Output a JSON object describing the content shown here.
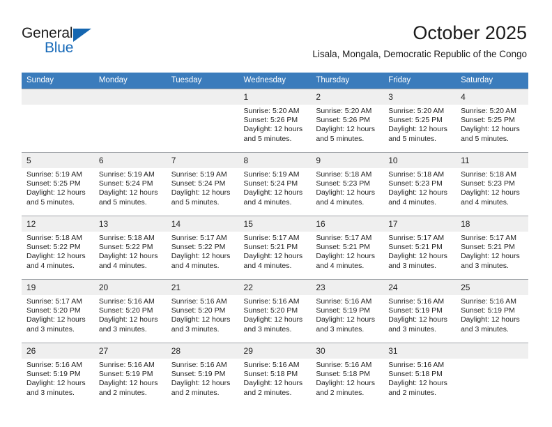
{
  "brand": {
    "name_top": "General",
    "name_bottom": "Blue",
    "accent_color": "#1669b8",
    "triangle_color": "#1566b0"
  },
  "header": {
    "title": "October 2025",
    "subtitle": "Lisala, Mongala, Democratic Republic of the Congo"
  },
  "calendar": {
    "header_background": "#3b7cbc",
    "daynum_background": "#efefef",
    "weekday_headers": [
      "Sunday",
      "Monday",
      "Tuesday",
      "Wednesday",
      "Thursday",
      "Friday",
      "Saturday"
    ],
    "weeks": [
      [
        {
          "day": "",
          "sunrise": "",
          "sunset": "",
          "daylight": "",
          "empty": true
        },
        {
          "day": "",
          "sunrise": "",
          "sunset": "",
          "daylight": "",
          "empty": true
        },
        {
          "day": "",
          "sunrise": "",
          "sunset": "",
          "daylight": "",
          "empty": true
        },
        {
          "day": "1",
          "sunrise": "Sunrise: 5:20 AM",
          "sunset": "Sunset: 5:26 PM",
          "daylight": "Daylight: 12 hours and 5 minutes."
        },
        {
          "day": "2",
          "sunrise": "Sunrise: 5:20 AM",
          "sunset": "Sunset: 5:26 PM",
          "daylight": "Daylight: 12 hours and 5 minutes."
        },
        {
          "day": "3",
          "sunrise": "Sunrise: 5:20 AM",
          "sunset": "Sunset: 5:25 PM",
          "daylight": "Daylight: 12 hours and 5 minutes."
        },
        {
          "day": "4",
          "sunrise": "Sunrise: 5:20 AM",
          "sunset": "Sunset: 5:25 PM",
          "daylight": "Daylight: 12 hours and 5 minutes."
        }
      ],
      [
        {
          "day": "5",
          "sunrise": "Sunrise: 5:19 AM",
          "sunset": "Sunset: 5:25 PM",
          "daylight": "Daylight: 12 hours and 5 minutes."
        },
        {
          "day": "6",
          "sunrise": "Sunrise: 5:19 AM",
          "sunset": "Sunset: 5:24 PM",
          "daylight": "Daylight: 12 hours and 5 minutes."
        },
        {
          "day": "7",
          "sunrise": "Sunrise: 5:19 AM",
          "sunset": "Sunset: 5:24 PM",
          "daylight": "Daylight: 12 hours and 5 minutes."
        },
        {
          "day": "8",
          "sunrise": "Sunrise: 5:19 AM",
          "sunset": "Sunset: 5:24 PM",
          "daylight": "Daylight: 12 hours and 4 minutes."
        },
        {
          "day": "9",
          "sunrise": "Sunrise: 5:18 AM",
          "sunset": "Sunset: 5:23 PM",
          "daylight": "Daylight: 12 hours and 4 minutes."
        },
        {
          "day": "10",
          "sunrise": "Sunrise: 5:18 AM",
          "sunset": "Sunset: 5:23 PM",
          "daylight": "Daylight: 12 hours and 4 minutes."
        },
        {
          "day": "11",
          "sunrise": "Sunrise: 5:18 AM",
          "sunset": "Sunset: 5:23 PM",
          "daylight": "Daylight: 12 hours and 4 minutes."
        }
      ],
      [
        {
          "day": "12",
          "sunrise": "Sunrise: 5:18 AM",
          "sunset": "Sunset: 5:22 PM",
          "daylight": "Daylight: 12 hours and 4 minutes."
        },
        {
          "day": "13",
          "sunrise": "Sunrise: 5:18 AM",
          "sunset": "Sunset: 5:22 PM",
          "daylight": "Daylight: 12 hours and 4 minutes."
        },
        {
          "day": "14",
          "sunrise": "Sunrise: 5:17 AM",
          "sunset": "Sunset: 5:22 PM",
          "daylight": "Daylight: 12 hours and 4 minutes."
        },
        {
          "day": "15",
          "sunrise": "Sunrise: 5:17 AM",
          "sunset": "Sunset: 5:21 PM",
          "daylight": "Daylight: 12 hours and 4 minutes."
        },
        {
          "day": "16",
          "sunrise": "Sunrise: 5:17 AM",
          "sunset": "Sunset: 5:21 PM",
          "daylight": "Daylight: 12 hours and 4 minutes."
        },
        {
          "day": "17",
          "sunrise": "Sunrise: 5:17 AM",
          "sunset": "Sunset: 5:21 PM",
          "daylight": "Daylight: 12 hours and 3 minutes."
        },
        {
          "day": "18",
          "sunrise": "Sunrise: 5:17 AM",
          "sunset": "Sunset: 5:21 PM",
          "daylight": "Daylight: 12 hours and 3 minutes."
        }
      ],
      [
        {
          "day": "19",
          "sunrise": "Sunrise: 5:17 AM",
          "sunset": "Sunset: 5:20 PM",
          "daylight": "Daylight: 12 hours and 3 minutes."
        },
        {
          "day": "20",
          "sunrise": "Sunrise: 5:16 AM",
          "sunset": "Sunset: 5:20 PM",
          "daylight": "Daylight: 12 hours and 3 minutes."
        },
        {
          "day": "21",
          "sunrise": "Sunrise: 5:16 AM",
          "sunset": "Sunset: 5:20 PM",
          "daylight": "Daylight: 12 hours and 3 minutes."
        },
        {
          "day": "22",
          "sunrise": "Sunrise: 5:16 AM",
          "sunset": "Sunset: 5:20 PM",
          "daylight": "Daylight: 12 hours and 3 minutes."
        },
        {
          "day": "23",
          "sunrise": "Sunrise: 5:16 AM",
          "sunset": "Sunset: 5:19 PM",
          "daylight": "Daylight: 12 hours and 3 minutes."
        },
        {
          "day": "24",
          "sunrise": "Sunrise: 5:16 AM",
          "sunset": "Sunset: 5:19 PM",
          "daylight": "Daylight: 12 hours and 3 minutes."
        },
        {
          "day": "25",
          "sunrise": "Sunrise: 5:16 AM",
          "sunset": "Sunset: 5:19 PM",
          "daylight": "Daylight: 12 hours and 3 minutes."
        }
      ],
      [
        {
          "day": "26",
          "sunrise": "Sunrise: 5:16 AM",
          "sunset": "Sunset: 5:19 PM",
          "daylight": "Daylight: 12 hours and 3 minutes."
        },
        {
          "day": "27",
          "sunrise": "Sunrise: 5:16 AM",
          "sunset": "Sunset: 5:19 PM",
          "daylight": "Daylight: 12 hours and 2 minutes."
        },
        {
          "day": "28",
          "sunrise": "Sunrise: 5:16 AM",
          "sunset": "Sunset: 5:19 PM",
          "daylight": "Daylight: 12 hours and 2 minutes."
        },
        {
          "day": "29",
          "sunrise": "Sunrise: 5:16 AM",
          "sunset": "Sunset: 5:18 PM",
          "daylight": "Daylight: 12 hours and 2 minutes."
        },
        {
          "day": "30",
          "sunrise": "Sunrise: 5:16 AM",
          "sunset": "Sunset: 5:18 PM",
          "daylight": "Daylight: 12 hours and 2 minutes."
        },
        {
          "day": "31",
          "sunrise": "Sunrise: 5:16 AM",
          "sunset": "Sunset: 5:18 PM",
          "daylight": "Daylight: 12 hours and 2 minutes."
        },
        {
          "day": "",
          "sunrise": "",
          "sunset": "",
          "daylight": "",
          "empty": true
        }
      ]
    ]
  }
}
